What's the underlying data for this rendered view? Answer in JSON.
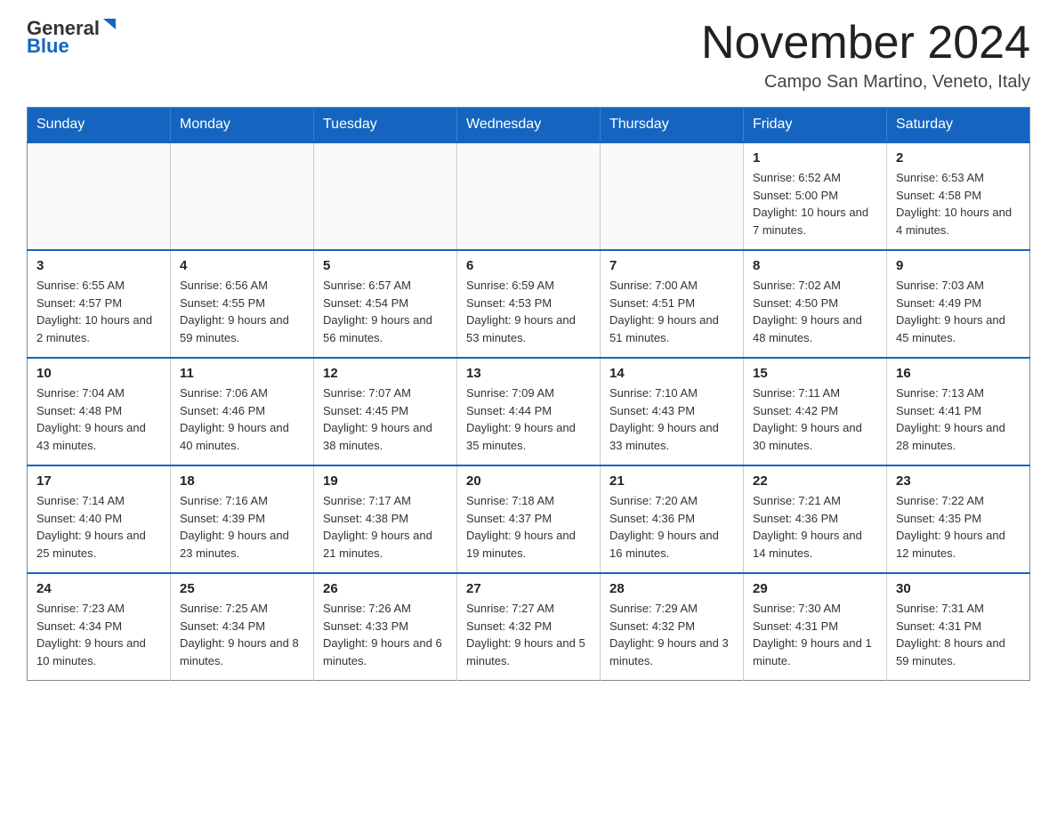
{
  "header": {
    "logo_general": "General",
    "logo_blue": "Blue",
    "month_title": "November 2024",
    "location": "Campo San Martino, Veneto, Italy"
  },
  "days_of_week": [
    "Sunday",
    "Monday",
    "Tuesday",
    "Wednesday",
    "Thursday",
    "Friday",
    "Saturday"
  ],
  "weeks": [
    [
      {
        "day": "",
        "info": ""
      },
      {
        "day": "",
        "info": ""
      },
      {
        "day": "",
        "info": ""
      },
      {
        "day": "",
        "info": ""
      },
      {
        "day": "",
        "info": ""
      },
      {
        "day": "1",
        "info": "Sunrise: 6:52 AM\nSunset: 5:00 PM\nDaylight: 10 hours and 7 minutes."
      },
      {
        "day": "2",
        "info": "Sunrise: 6:53 AM\nSunset: 4:58 PM\nDaylight: 10 hours and 4 minutes."
      }
    ],
    [
      {
        "day": "3",
        "info": "Sunrise: 6:55 AM\nSunset: 4:57 PM\nDaylight: 10 hours and 2 minutes."
      },
      {
        "day": "4",
        "info": "Sunrise: 6:56 AM\nSunset: 4:55 PM\nDaylight: 9 hours and 59 minutes."
      },
      {
        "day": "5",
        "info": "Sunrise: 6:57 AM\nSunset: 4:54 PM\nDaylight: 9 hours and 56 minutes."
      },
      {
        "day": "6",
        "info": "Sunrise: 6:59 AM\nSunset: 4:53 PM\nDaylight: 9 hours and 53 minutes."
      },
      {
        "day": "7",
        "info": "Sunrise: 7:00 AM\nSunset: 4:51 PM\nDaylight: 9 hours and 51 minutes."
      },
      {
        "day": "8",
        "info": "Sunrise: 7:02 AM\nSunset: 4:50 PM\nDaylight: 9 hours and 48 minutes."
      },
      {
        "day": "9",
        "info": "Sunrise: 7:03 AM\nSunset: 4:49 PM\nDaylight: 9 hours and 45 minutes."
      }
    ],
    [
      {
        "day": "10",
        "info": "Sunrise: 7:04 AM\nSunset: 4:48 PM\nDaylight: 9 hours and 43 minutes."
      },
      {
        "day": "11",
        "info": "Sunrise: 7:06 AM\nSunset: 4:46 PM\nDaylight: 9 hours and 40 minutes."
      },
      {
        "day": "12",
        "info": "Sunrise: 7:07 AM\nSunset: 4:45 PM\nDaylight: 9 hours and 38 minutes."
      },
      {
        "day": "13",
        "info": "Sunrise: 7:09 AM\nSunset: 4:44 PM\nDaylight: 9 hours and 35 minutes."
      },
      {
        "day": "14",
        "info": "Sunrise: 7:10 AM\nSunset: 4:43 PM\nDaylight: 9 hours and 33 minutes."
      },
      {
        "day": "15",
        "info": "Sunrise: 7:11 AM\nSunset: 4:42 PM\nDaylight: 9 hours and 30 minutes."
      },
      {
        "day": "16",
        "info": "Sunrise: 7:13 AM\nSunset: 4:41 PM\nDaylight: 9 hours and 28 minutes."
      }
    ],
    [
      {
        "day": "17",
        "info": "Sunrise: 7:14 AM\nSunset: 4:40 PM\nDaylight: 9 hours and 25 minutes."
      },
      {
        "day": "18",
        "info": "Sunrise: 7:16 AM\nSunset: 4:39 PM\nDaylight: 9 hours and 23 minutes."
      },
      {
        "day": "19",
        "info": "Sunrise: 7:17 AM\nSunset: 4:38 PM\nDaylight: 9 hours and 21 minutes."
      },
      {
        "day": "20",
        "info": "Sunrise: 7:18 AM\nSunset: 4:37 PM\nDaylight: 9 hours and 19 minutes."
      },
      {
        "day": "21",
        "info": "Sunrise: 7:20 AM\nSunset: 4:36 PM\nDaylight: 9 hours and 16 minutes."
      },
      {
        "day": "22",
        "info": "Sunrise: 7:21 AM\nSunset: 4:36 PM\nDaylight: 9 hours and 14 minutes."
      },
      {
        "day": "23",
        "info": "Sunrise: 7:22 AM\nSunset: 4:35 PM\nDaylight: 9 hours and 12 minutes."
      }
    ],
    [
      {
        "day": "24",
        "info": "Sunrise: 7:23 AM\nSunset: 4:34 PM\nDaylight: 9 hours and 10 minutes."
      },
      {
        "day": "25",
        "info": "Sunrise: 7:25 AM\nSunset: 4:34 PM\nDaylight: 9 hours and 8 minutes."
      },
      {
        "day": "26",
        "info": "Sunrise: 7:26 AM\nSunset: 4:33 PM\nDaylight: 9 hours and 6 minutes."
      },
      {
        "day": "27",
        "info": "Sunrise: 7:27 AM\nSunset: 4:32 PM\nDaylight: 9 hours and 5 minutes."
      },
      {
        "day": "28",
        "info": "Sunrise: 7:29 AM\nSunset: 4:32 PM\nDaylight: 9 hours and 3 minutes."
      },
      {
        "day": "29",
        "info": "Sunrise: 7:30 AM\nSunset: 4:31 PM\nDaylight: 9 hours and 1 minute."
      },
      {
        "day": "30",
        "info": "Sunrise: 7:31 AM\nSunset: 4:31 PM\nDaylight: 8 hours and 59 minutes."
      }
    ]
  ]
}
